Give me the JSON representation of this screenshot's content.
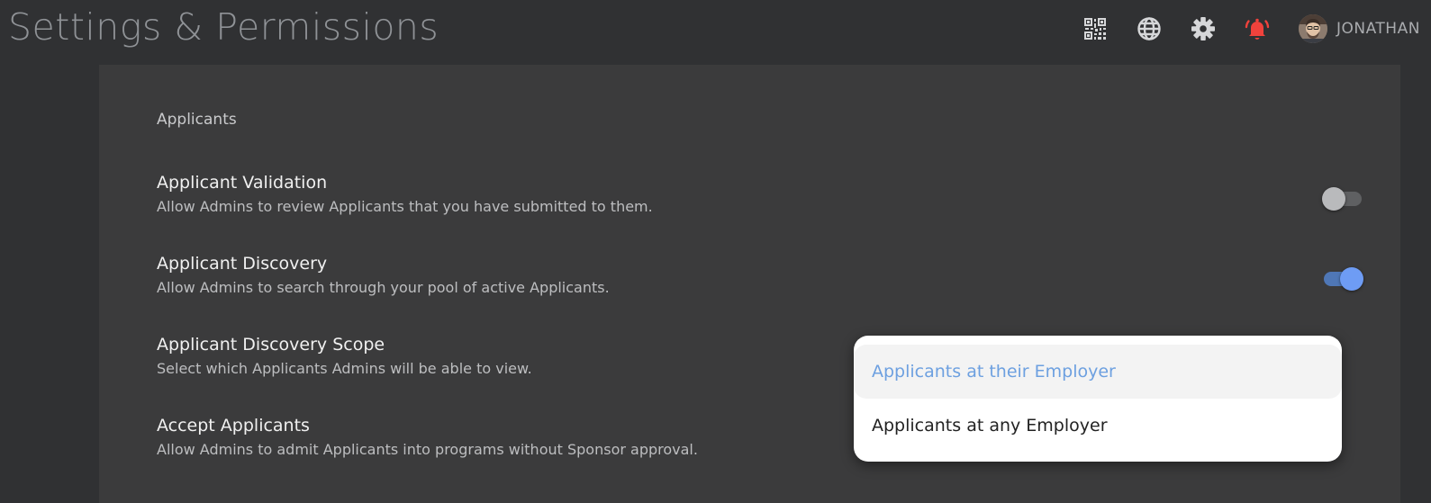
{
  "header": {
    "title": "Settings & Permissions",
    "icons": [
      "qr-code-icon",
      "globe-icon",
      "gear-icon",
      "bell-alert-icon"
    ],
    "user_name": "JONATHAN"
  },
  "colors": {
    "background": "#303133",
    "panel": "#3b3b3c",
    "accent_blue": "#6e9cf4",
    "alert_red": "#f0423c"
  },
  "section": {
    "title": "Applicants",
    "rows": [
      {
        "title": "Applicant Validation",
        "description": "Allow Admins to review Applicants that you have submitted to them.",
        "toggle": "off"
      },
      {
        "title": "Applicant Discovery",
        "description": "Allow Admins to search through your pool of active Applicants.",
        "toggle": "on"
      },
      {
        "title": "Applicant Discovery Scope",
        "description": "Select which Applicants Admins will be able to view."
      },
      {
        "title": "Accept Applicants",
        "description": "Allow Admins to admit Applicants into programs without Sponsor approval."
      }
    ]
  },
  "dropdown": {
    "selected": "Applicants at their Employer",
    "options": [
      "Applicants at their Employer",
      "Applicants at any Employer"
    ]
  }
}
